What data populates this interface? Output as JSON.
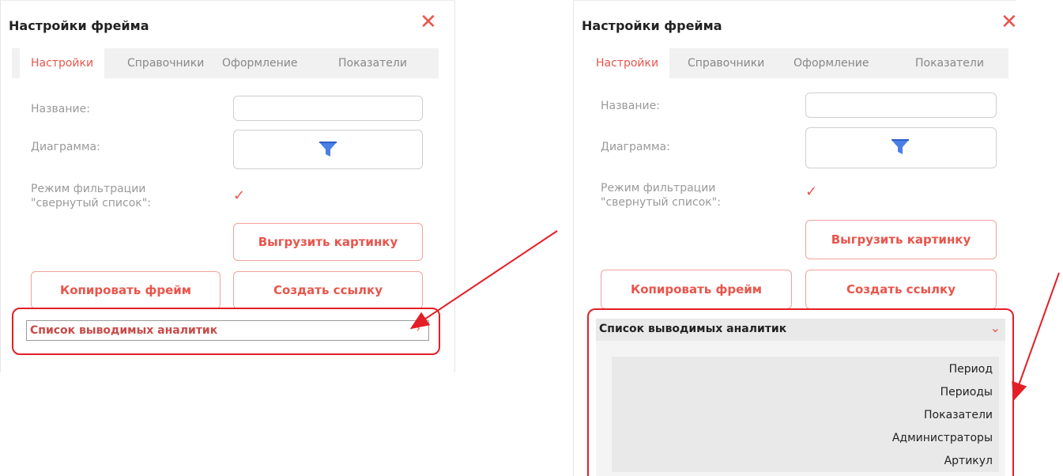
{
  "dialog": {
    "title": "Настройки фрейма",
    "close_icon": "close-x-icon",
    "tabs": [
      "Настройки",
      "Справочники",
      "Оформление",
      "Показатели"
    ],
    "active_tab": "Настройки",
    "fields": {
      "name_label": "Название:",
      "name_value": "",
      "diagram_label": "Диаграмма:",
      "diagram_icon": "funnel-filter-icon",
      "filter_mode_label_line1": "Режим фильтрации",
      "filter_mode_label_line2": "\"свернутый список\":",
      "filter_mode_checked": true
    },
    "buttons": {
      "export_image": "Выгрузить картинку",
      "copy_frame": "Копировать фрейм",
      "create_link": "Создать ссылку"
    },
    "analytics_section": {
      "title": "Список выводимых аналитик",
      "collapsed_chevron": "chevron-right-icon",
      "expanded_chevron": "chevron-down-icon",
      "items": [
        "Период",
        "Периоды",
        "Показатели",
        "Администраторы",
        "Артикул"
      ]
    }
  },
  "colors": {
    "accent": "#e8554b",
    "annotation": "#e41e26",
    "tab_bar": "#f1f1f1",
    "list_bg": "#e9e9e9"
  }
}
